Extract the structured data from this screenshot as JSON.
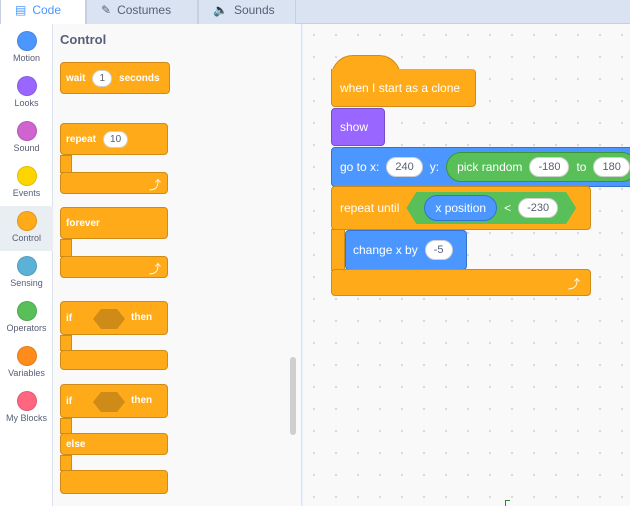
{
  "tabs": [
    {
      "label": "Code",
      "icon": "code-icon",
      "active": true
    },
    {
      "label": "Costumes",
      "icon": "brush-icon",
      "active": false
    },
    {
      "label": "Sounds",
      "icon": "speaker-icon",
      "active": false
    }
  ],
  "categories": [
    {
      "label": "Motion",
      "color": "#4c97ff"
    },
    {
      "label": "Looks",
      "color": "#9966ff"
    },
    {
      "label": "Sound",
      "color": "#cf63cf"
    },
    {
      "label": "Events",
      "color": "#ffd500"
    },
    {
      "label": "Control",
      "color": "#ffab19",
      "selected": true
    },
    {
      "label": "Sensing",
      "color": "#5cb1d6"
    },
    {
      "label": "Operators",
      "color": "#59c059"
    },
    {
      "label": "Variables",
      "color": "#ff8c1a"
    },
    {
      "label": "My Blocks",
      "color": "#ff6680"
    }
  ],
  "palette": {
    "title": "Control",
    "wait": {
      "prefix": "wait",
      "value": "1",
      "suffix": "seconds"
    },
    "repeat": {
      "label": "repeat",
      "value": "10"
    },
    "forever": {
      "label": "forever"
    },
    "if_then": {
      "if": "if",
      "then": "then"
    },
    "if_else": {
      "if": "if",
      "then": "then",
      "else": "else"
    }
  },
  "script": {
    "hat": "when I start as a clone",
    "show": "show",
    "goto": {
      "label": "go to x:",
      "x": "240",
      "y_label": "y:",
      "random": "pick random",
      "from": "-180",
      "to_label": "to",
      "to": "180"
    },
    "repeat_until": {
      "label": "repeat until",
      "reporter": "x position",
      "op": "<",
      "value": "-230"
    },
    "change_x": {
      "label": "change x by",
      "value": "-5"
    }
  },
  "colors": {
    "control": "#ffab19",
    "looks": "#9966ff",
    "motion": "#4c97ff",
    "operators": "#59c059"
  }
}
